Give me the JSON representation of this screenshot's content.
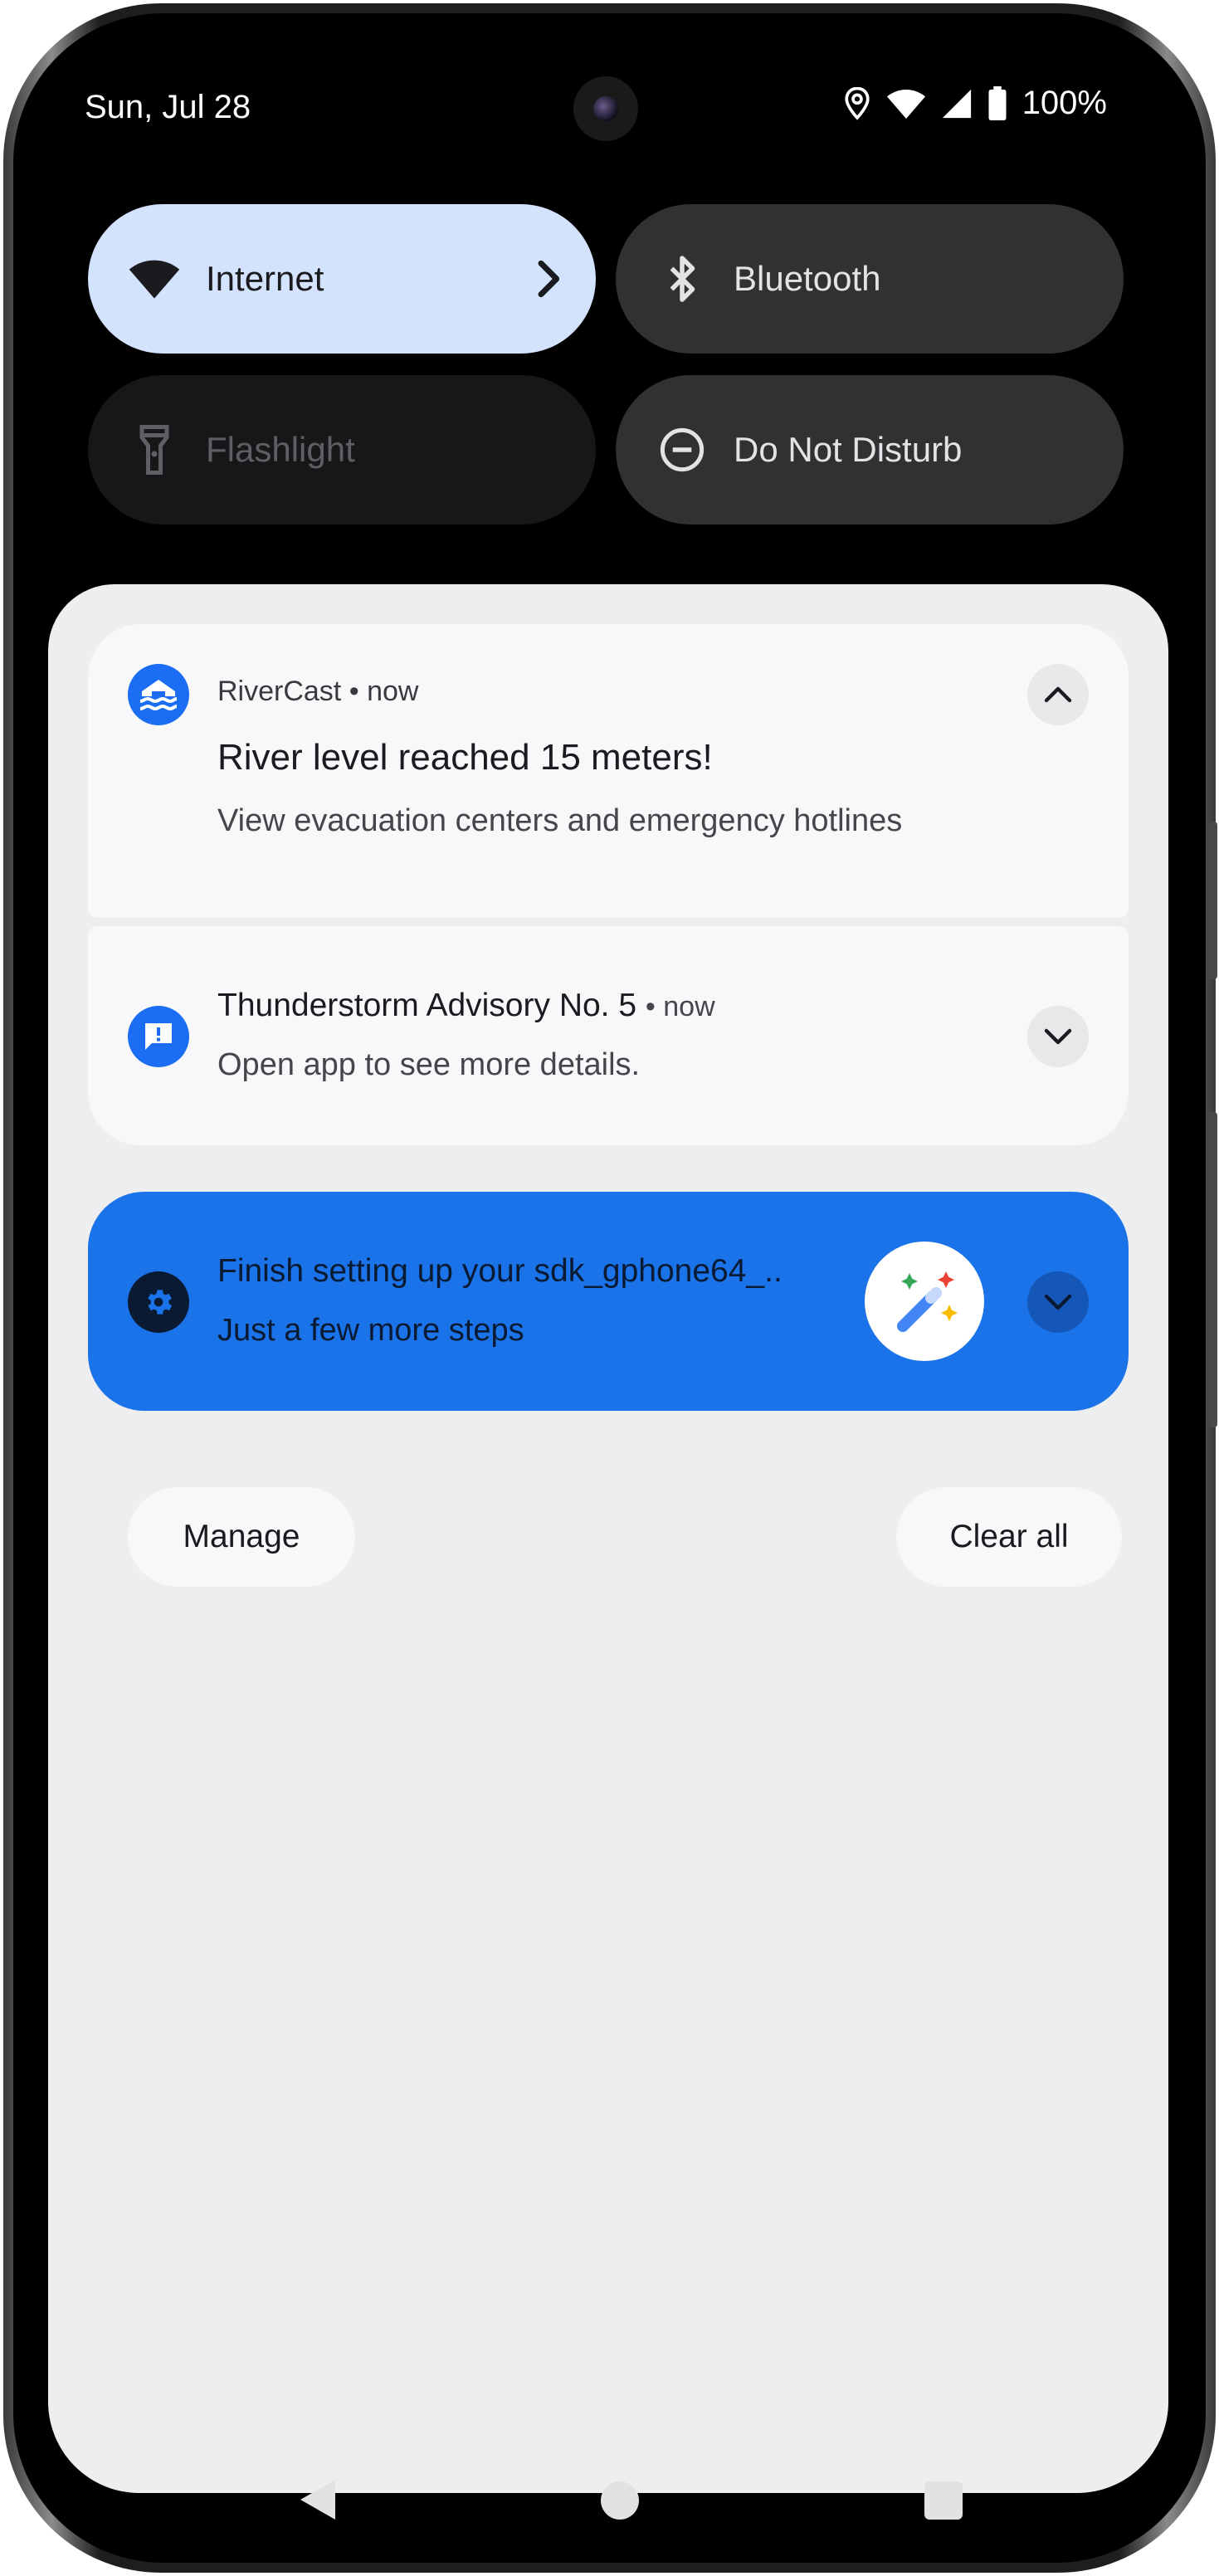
{
  "status_bar": {
    "date": "Sun, Jul 28",
    "battery": "100%",
    "icons": [
      "location-icon",
      "wifi-icon",
      "cell-signal-icon",
      "battery-icon"
    ]
  },
  "quick_settings": {
    "tiles": [
      {
        "label": "Internet",
        "icon": "wifi-icon",
        "state": "on"
      },
      {
        "label": "Bluetooth",
        "icon": "bluetooth-icon",
        "state": "off"
      },
      {
        "label": "Flashlight",
        "icon": "flashlight-icon",
        "state": "unavailable"
      },
      {
        "label": "Do Not Disturb",
        "icon": "do-not-disturb-icon",
        "state": "off"
      }
    ]
  },
  "notifications": [
    {
      "app": "RiverCast",
      "time": "now",
      "title": "River level reached 15 meters!",
      "text": "View evacuation centers and emergency hotlines",
      "expanded": true,
      "icon": "flood-icon"
    },
    {
      "title": "Thunderstorm Advisory No. 5",
      "time": "now",
      "text": "Open app to see more details.",
      "expanded": false,
      "icon": "alert-message-icon"
    },
    {
      "title": "Finish setting up your sdk_gphone64_..",
      "text": "Just a few more steps",
      "expanded": false,
      "icon": "settings-gear-icon",
      "large_icon": "magic-wand-icon"
    }
  ],
  "actions": {
    "manage": "Manage",
    "clear_all": "Clear all"
  },
  "colors": {
    "internet_tile": "#d3e3fd",
    "dark_tile": "#2f3133",
    "shade_bg": "#eeeef0",
    "card_bg": "#f8f8fa",
    "setup_card": "#1a73e8",
    "app_icon_blue": "#1b6ef3"
  }
}
